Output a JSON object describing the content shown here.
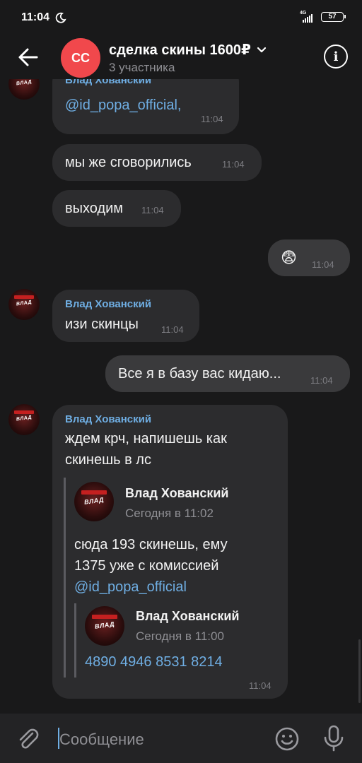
{
  "status_bar": {
    "time": "11:04",
    "network": "4G",
    "battery": "57"
  },
  "header": {
    "avatar_initials": "СС",
    "title": "сделка скины 1600₽",
    "subtitle": "3 участника",
    "info_glyph": "i"
  },
  "colors": {
    "background": "#19191a",
    "bubble_in": "#2c2c2e",
    "bubble_out": "#3a3a3c",
    "accent": "#6faee3",
    "avatar_red": "#f1484c"
  },
  "messages": [
    {
      "sender": "Влад Хованский",
      "text": "@id_popa_official,",
      "time": "11:04"
    },
    {
      "text": "мы же сговорились",
      "time": "11:04"
    },
    {
      "text": "выходим",
      "time": "11:04"
    },
    {
      "text": "😨",
      "time": "11:04"
    },
    {
      "sender": "Влад Хованский",
      "text": "изи скинцы",
      "time": "11:04"
    },
    {
      "text": "Все я в базу вас кидаю...",
      "time": "11:04"
    },
    {
      "sender": "Влад Хованский",
      "lines": [
        "ждем крч, напишешь как",
        "скинешь в лс"
      ],
      "time": "11:04",
      "forward": {
        "name": "Влад Хованский",
        "time": "Сегодня в 11:02",
        "lines": [
          "сюда 193 скинешь, ему",
          "1375 уже с комиссией"
        ],
        "link": "@id_popa_official",
        "forward": {
          "name": "Влад Хованский",
          "time": "Сегодня в 11:00",
          "text": "4890 4946 8531 8214"
        }
      }
    }
  ],
  "avatar_logo_text": "ВЛАД",
  "input": {
    "placeholder": "Сообщение"
  },
  "icons": {
    "back": "arrow-left-icon",
    "chevron": "chevron-down-icon",
    "info": "info-icon",
    "attach": "paperclip-icon",
    "emoji": "smiley-icon",
    "mic": "microphone-icon"
  }
}
